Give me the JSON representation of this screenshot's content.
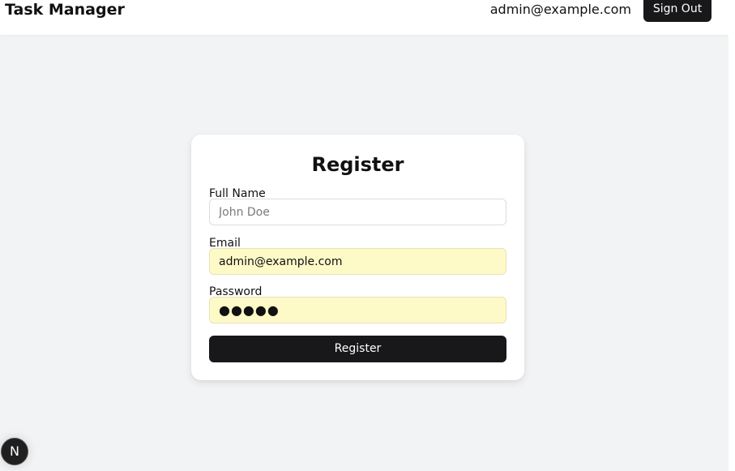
{
  "header": {
    "app_title": "Task Manager",
    "user_email": "admin@example.com",
    "signout_label": "Sign Out"
  },
  "register_form": {
    "title": "Register",
    "fields": [
      {
        "label": "Full Name",
        "placeholder": "John Doe",
        "value": ""
      },
      {
        "label": "Email",
        "placeholder": "",
        "value": "admin@example.com"
      },
      {
        "label": "Password",
        "placeholder": "",
        "value": "●●●●●"
      }
    ],
    "submit_label": "Register"
  },
  "dev_badge": {
    "letter": "N",
    "icon": "nextjs-logo-icon"
  },
  "colors": {
    "background": "#f2f3f5",
    "button_dark": "#18181b",
    "autofill": "#fefac8"
  }
}
